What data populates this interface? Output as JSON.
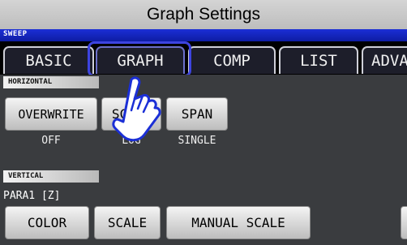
{
  "window": {
    "title": "Graph Settings"
  },
  "mode_label": "SWEEP",
  "tabs": [
    {
      "label": "BASIC"
    },
    {
      "label": "GRAPH"
    },
    {
      "label": "COMP"
    },
    {
      "label": "LIST"
    },
    {
      "label": "ADVA"
    }
  ],
  "horizontal": {
    "section_label": "HORIZONTAL",
    "buttons": [
      {
        "label": "OVERWRITE",
        "value": "OFF"
      },
      {
        "label": "SCALE",
        "value": "LOG"
      },
      {
        "label": "SPAN",
        "value": "SINGLE"
      }
    ]
  },
  "vertical": {
    "section_label": "VERTICAL",
    "para_label": "PARA1 [Z]",
    "buttons": [
      {
        "label": "COLOR"
      },
      {
        "label": "SCALE"
      },
      {
        "label": "MANUAL SCALE"
      }
    ]
  },
  "colors": {
    "highlight": "#3d44e0",
    "mode_bar": "#1b2fd6",
    "panel": "#3a3c3f"
  },
  "icons": {
    "pointer": "hand-pointer-icon"
  }
}
